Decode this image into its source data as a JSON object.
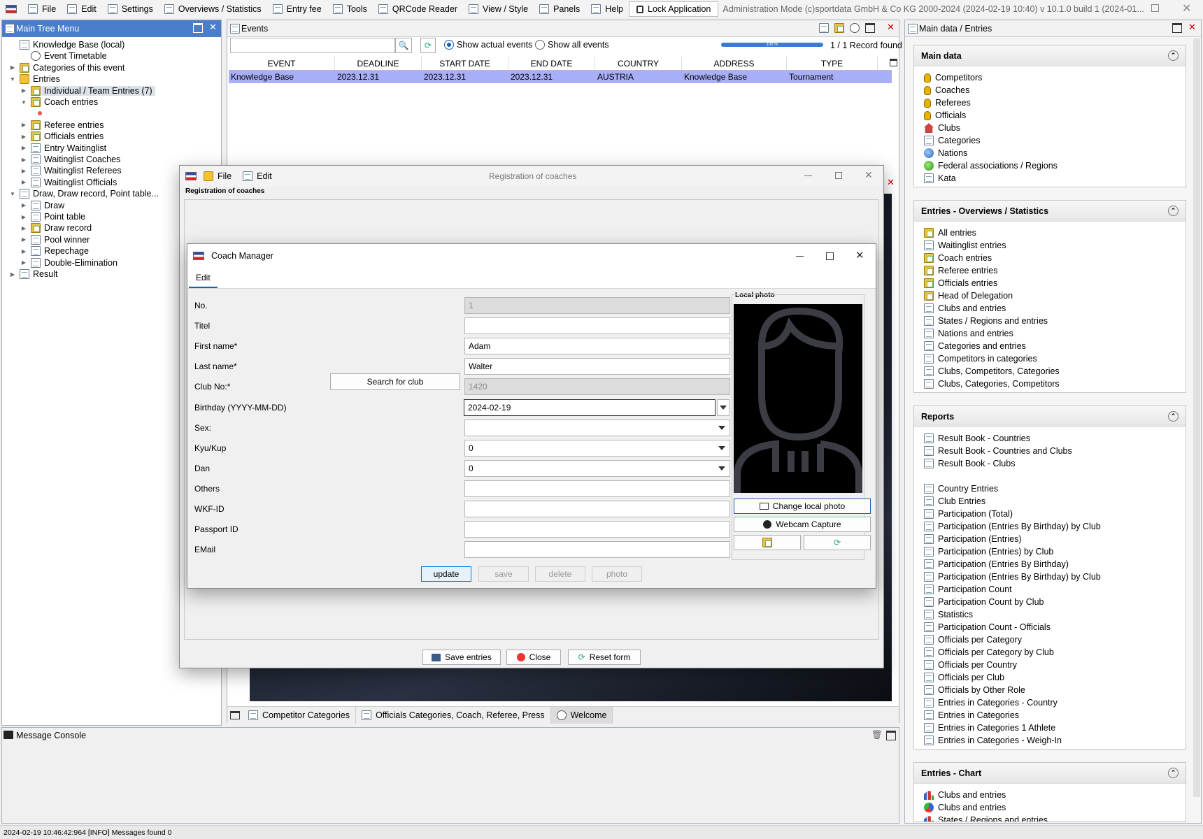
{
  "menubar": {
    "items": [
      {
        "label": "File",
        "icon": "folder-icon"
      },
      {
        "label": "Edit",
        "icon": "edit-icon"
      },
      {
        "label": "Settings",
        "icon": "gear-icon"
      },
      {
        "label": "Overviews / Statistics",
        "icon": "chart-icon"
      },
      {
        "label": "Entry fee",
        "icon": "money-icon"
      },
      {
        "label": "Tools",
        "icon": "wrench-icon"
      },
      {
        "label": "QRCode Reader",
        "icon": "qrcode-icon"
      },
      {
        "label": "View / Style",
        "icon": "window-icon"
      },
      {
        "label": "Panels",
        "icon": "panels-icon"
      },
      {
        "label": "Help",
        "icon": "help-icon"
      }
    ],
    "lock_label": "Lock Application",
    "title": "Administration Mode (c)sportdata GmbH & Co KG 2000-2024 (2024-02-19 10:40)  v 10.1.0 build 1 (2024-01..."
  },
  "tree": {
    "title": "Main Tree Menu",
    "rows": [
      {
        "label": "Knowledge Base (local)",
        "level": 0,
        "toggle": "",
        "icon": "i-doc"
      },
      {
        "label": "Event Timetable",
        "level": 1,
        "toggle": "",
        "icon": "i-circ"
      },
      {
        "label": "Categories of this event",
        "level": 1,
        "toggle": "▶",
        "icon": "i-fold2"
      },
      {
        "label": "Entries",
        "level": 0,
        "toggle": "▼",
        "icon": "i-fold"
      },
      {
        "label": "Individual / Team Entries (7)",
        "level": 2,
        "toggle": "▶",
        "icon": "i-fold2",
        "selected": true
      },
      {
        "label": "Coach entries",
        "level": 2,
        "toggle": "▼",
        "icon": "i-fold2"
      },
      {
        "label": "",
        "level": 3,
        "toggle": "",
        "icon": "dot"
      },
      {
        "label": "Referee entries",
        "level": 2,
        "toggle": "▶",
        "icon": "i-fold2"
      },
      {
        "label": "Officials entries",
        "level": 2,
        "toggle": "▶",
        "icon": "i-fold2"
      },
      {
        "label": "Entry Waitinglist",
        "level": 2,
        "toggle": "▶",
        "icon": "i-doc"
      },
      {
        "label": "Waitinglist Coaches",
        "level": 2,
        "toggle": "▶",
        "icon": "i-doc"
      },
      {
        "label": "Waitinglist Referees",
        "level": 2,
        "toggle": "▶",
        "icon": "i-doc"
      },
      {
        "label": "Waitinglist Officials",
        "level": 2,
        "toggle": "▶",
        "icon": "i-doc"
      },
      {
        "label": "Draw, Draw record, Point table...",
        "level": 0,
        "toggle": "▼",
        "icon": "i-doc"
      },
      {
        "label": "Draw",
        "level": 2,
        "toggle": "▶",
        "icon": "i-doc"
      },
      {
        "label": "Point table",
        "level": 2,
        "toggle": "▶",
        "icon": "i-doc"
      },
      {
        "label": "Draw record",
        "level": 2,
        "toggle": "▶",
        "icon": "i-fold2"
      },
      {
        "label": "Pool winner",
        "level": 2,
        "toggle": "▶",
        "icon": "i-doc"
      },
      {
        "label": "Repechage",
        "level": 2,
        "toggle": "▶",
        "icon": "i-doc"
      },
      {
        "label": "Double-Elimination",
        "level": 2,
        "toggle": "▶",
        "icon": "i-doc"
      },
      {
        "label": "Result",
        "level": 0,
        "toggle": "▶",
        "icon": "i-doc"
      }
    ]
  },
  "events": {
    "title": "Events",
    "search_value": "",
    "radio_actual": "Show actual events",
    "radio_all": "Show all events",
    "record_count": "1 / 1 Record found",
    "progress_label": "100 %",
    "columns": [
      "EVENT",
      "DEADLINE",
      "START DATE",
      "END DATE",
      "COUNTRY",
      "ADDRESS",
      "TYPE"
    ],
    "rows": [
      [
        "Knowledge Base",
        "2023.12.31",
        "2023.12.31",
        "2023.12.31",
        "AUSTRIA",
        "Knowledge Base",
        "Tournament"
      ]
    ]
  },
  "registration": {
    "title": "Registration of coaches",
    "menu_file": "File",
    "menu_edit": "Edit",
    "group_label": "Registration of coaches",
    "save_label": "Save entries",
    "close_label": "Close",
    "reset_label": "Reset form"
  },
  "coach": {
    "title": "Coach Manager",
    "tab_edit": "Edit",
    "labels": {
      "no": "No.",
      "titel": "Titel",
      "first": "First name*",
      "last": "Last name*",
      "club": "Club No:*",
      "birthday": "Birthday (YYYY-MM-DD)",
      "sex": "Sex:",
      "kyu": "Kyu/Kup",
      "dan": "Dan",
      "others": "Others",
      "wkf": "WKF-ID",
      "passport": "Passport ID",
      "email": "EMail"
    },
    "values": {
      "no": "1",
      "titel": "",
      "first": "Adam",
      "last": "Walter",
      "club": "1420",
      "birthday": "2024-02-19",
      "sex": "",
      "kyu": "0",
      "dan": "0",
      "others": "",
      "wkf": "",
      "passport": "",
      "email": ""
    },
    "search_club": "Search for club",
    "photo_label": "Local photo",
    "change_photo": "Change local photo",
    "webcam": "Webcam Capture",
    "btn_update": "update",
    "btn_save": "save",
    "btn_delete": "delete",
    "btn_photo": "photo"
  },
  "bottom_tabs": [
    {
      "label": "Competitor Categories"
    },
    {
      "label": "Officials Categories, Coach, Referee, Press"
    },
    {
      "label": "Welcome"
    }
  ],
  "console": {
    "title": "Message Console"
  },
  "status": {
    "text": "2024-02-19 10:46:42:964 [INFO] Messages found 0"
  },
  "right": {
    "title": "Main data / Entries",
    "sections": [
      {
        "title": "Main data",
        "items": [
          [
            "Competitors",
            "i-pin"
          ],
          [
            "Coaches",
            "i-pin"
          ],
          [
            "Referees",
            "i-pin"
          ],
          [
            "Officials",
            "i-pin"
          ],
          [
            "Clubs",
            "i-house"
          ],
          [
            "Categories",
            "i-doc"
          ],
          [
            "Nations",
            "i-globe"
          ],
          [
            "Federal associations / Regions",
            "i-green"
          ],
          [
            "Kata",
            "i-doc"
          ]
        ]
      },
      {
        "title": "Entries - Overviews / Statistics",
        "items": [
          [
            "All entries",
            "i-fold2"
          ],
          [
            "Waitinglist entries",
            "i-doc"
          ],
          [
            "Coach entries",
            "i-fold2"
          ],
          [
            "Referee entries",
            "i-fold2"
          ],
          [
            "Officials entries",
            "i-fold2"
          ],
          [
            "Head of Delegation",
            "i-fold2"
          ],
          [
            "Clubs and entries",
            "i-doc"
          ],
          [
            "States / Regions and entries",
            "i-doc"
          ],
          [
            "Nations and entries",
            "i-doc"
          ],
          [
            "Categories and entries",
            "i-doc"
          ],
          [
            "Competitors in categories",
            "i-doc"
          ],
          [
            "Clubs, Competitors, Categories",
            "i-doc"
          ],
          [
            "Clubs, Categories, Competitors",
            "i-doc"
          ]
        ]
      },
      {
        "title": "Reports",
        "items": [
          [
            "Result Book - Countries",
            "i-doc"
          ],
          [
            "Result Book - Countries and Clubs",
            "i-doc"
          ],
          [
            "Result Book - Clubs",
            "i-doc"
          ],
          [
            "",
            ""
          ],
          [
            "Country Entries",
            "i-doc"
          ],
          [
            "Club Entries",
            "i-doc"
          ],
          [
            "Participation (Total)",
            "i-doc"
          ],
          [
            "Participation (Entries By Birthday) by Club",
            "i-doc"
          ],
          [
            "Participation (Entries)",
            "i-doc"
          ],
          [
            "Participation (Entries) by Club",
            "i-doc"
          ],
          [
            "Participation (Entries By Birthday)",
            "i-doc"
          ],
          [
            "Participation (Entries By Birthday) by Club",
            "i-doc"
          ],
          [
            "Participation Count",
            "i-doc"
          ],
          [
            "Participation Count by Club",
            "i-doc"
          ],
          [
            "Statistics",
            "i-doc"
          ],
          [
            "Participation Count - Officials",
            "i-doc"
          ],
          [
            "Officials per Category",
            "i-doc"
          ],
          [
            "Officials per Category by Club",
            "i-doc"
          ],
          [
            "Officials per Country",
            "i-doc"
          ],
          [
            "Officials per Club",
            "i-doc"
          ],
          [
            "Officials by Other Role",
            "i-doc"
          ],
          [
            "Entries in Categories - Country",
            "i-doc"
          ],
          [
            "Entries in Categories",
            "i-doc"
          ],
          [
            "Entries in Categories 1 Athlete",
            "i-doc"
          ],
          [
            "Entries in Categories - Weigh-In",
            "i-doc"
          ]
        ]
      },
      {
        "title": "Entries - Chart",
        "items": [
          [
            "Clubs and entries",
            "i-chart"
          ],
          [
            "Clubs and entries",
            "i-pie"
          ],
          [
            "States / Regions and entries",
            "i-chart"
          ]
        ]
      }
    ]
  }
}
